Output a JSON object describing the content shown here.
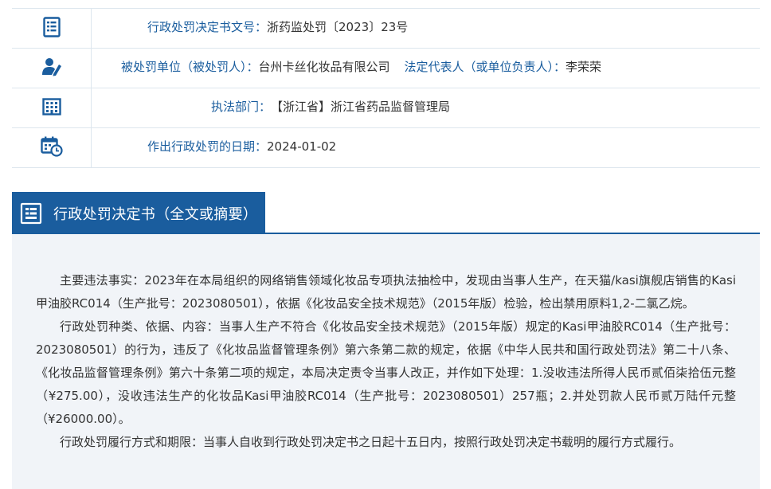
{
  "info": {
    "rows": [
      {
        "icon": "document-list-icon",
        "label": "行政处罚决定书文号：",
        "value": "浙药监处罚〔2023〕23号"
      },
      {
        "icon": "person-edit-icon",
        "label": "被处罚单位（被处罚人）：",
        "value": "台州卡丝化妆品有限公司",
        "label2": "法定代表人（或单位负责人）：",
        "value2": "李荣荣"
      },
      {
        "icon": "building-icon",
        "label": "执法部门：",
        "value": "【浙江省】浙江省药品监督管理局"
      },
      {
        "icon": "calendar-clock-icon",
        "label": "作出行政处罚的日期：",
        "value": "2024-01-02"
      }
    ]
  },
  "section": {
    "title": "行政处罚决定书（全文或摘要）",
    "icon": "document-icon"
  },
  "body": {
    "paragraphs": [
      "主要违法事实：2023年在本局组织的网络销售领域化妆品专项执法抽检中，发现由当事人生产，在天猫/kasi旗舰店销售的Kasi甲油胶RC014（生产批号：2023080501），依据《化妆品安全技术规范》（2015年版）检验，检出禁用原料1,2-二氯乙烷。",
      "行政处罚种类、依据、内容：当事人生产不符合《化妆品安全技术规范》（2015年版）规定的Kasi甲油胶RC014（生产批号：2023080501）的行为，违反了《化妆品监督管理条例》第六条第二款的规定，依据《中华人民共和国行政处罚法》第二十八条、《化妆品监督管理条例》第六十条第二项的规定，本局决定责令当事人改正，并作如下处理：1.没收违法所得人民币贰佰柒拾伍元整（¥275.00），没收违法生产的化妆品Kasi甲油胶RC014（生产批号：2023080501）257瓶；2.并处罚款人民币贰万陆仟元整（¥26000.00）。",
      "行政处罚履行方式和期限：当事人自收到行政处罚决定书之日起十五日内，按照行政处罚决定书载明的履行方式履行。"
    ]
  },
  "colors": {
    "accent": "#1a5d9e",
    "panel": "#f1f4f8",
    "border": "#dde6ee"
  }
}
